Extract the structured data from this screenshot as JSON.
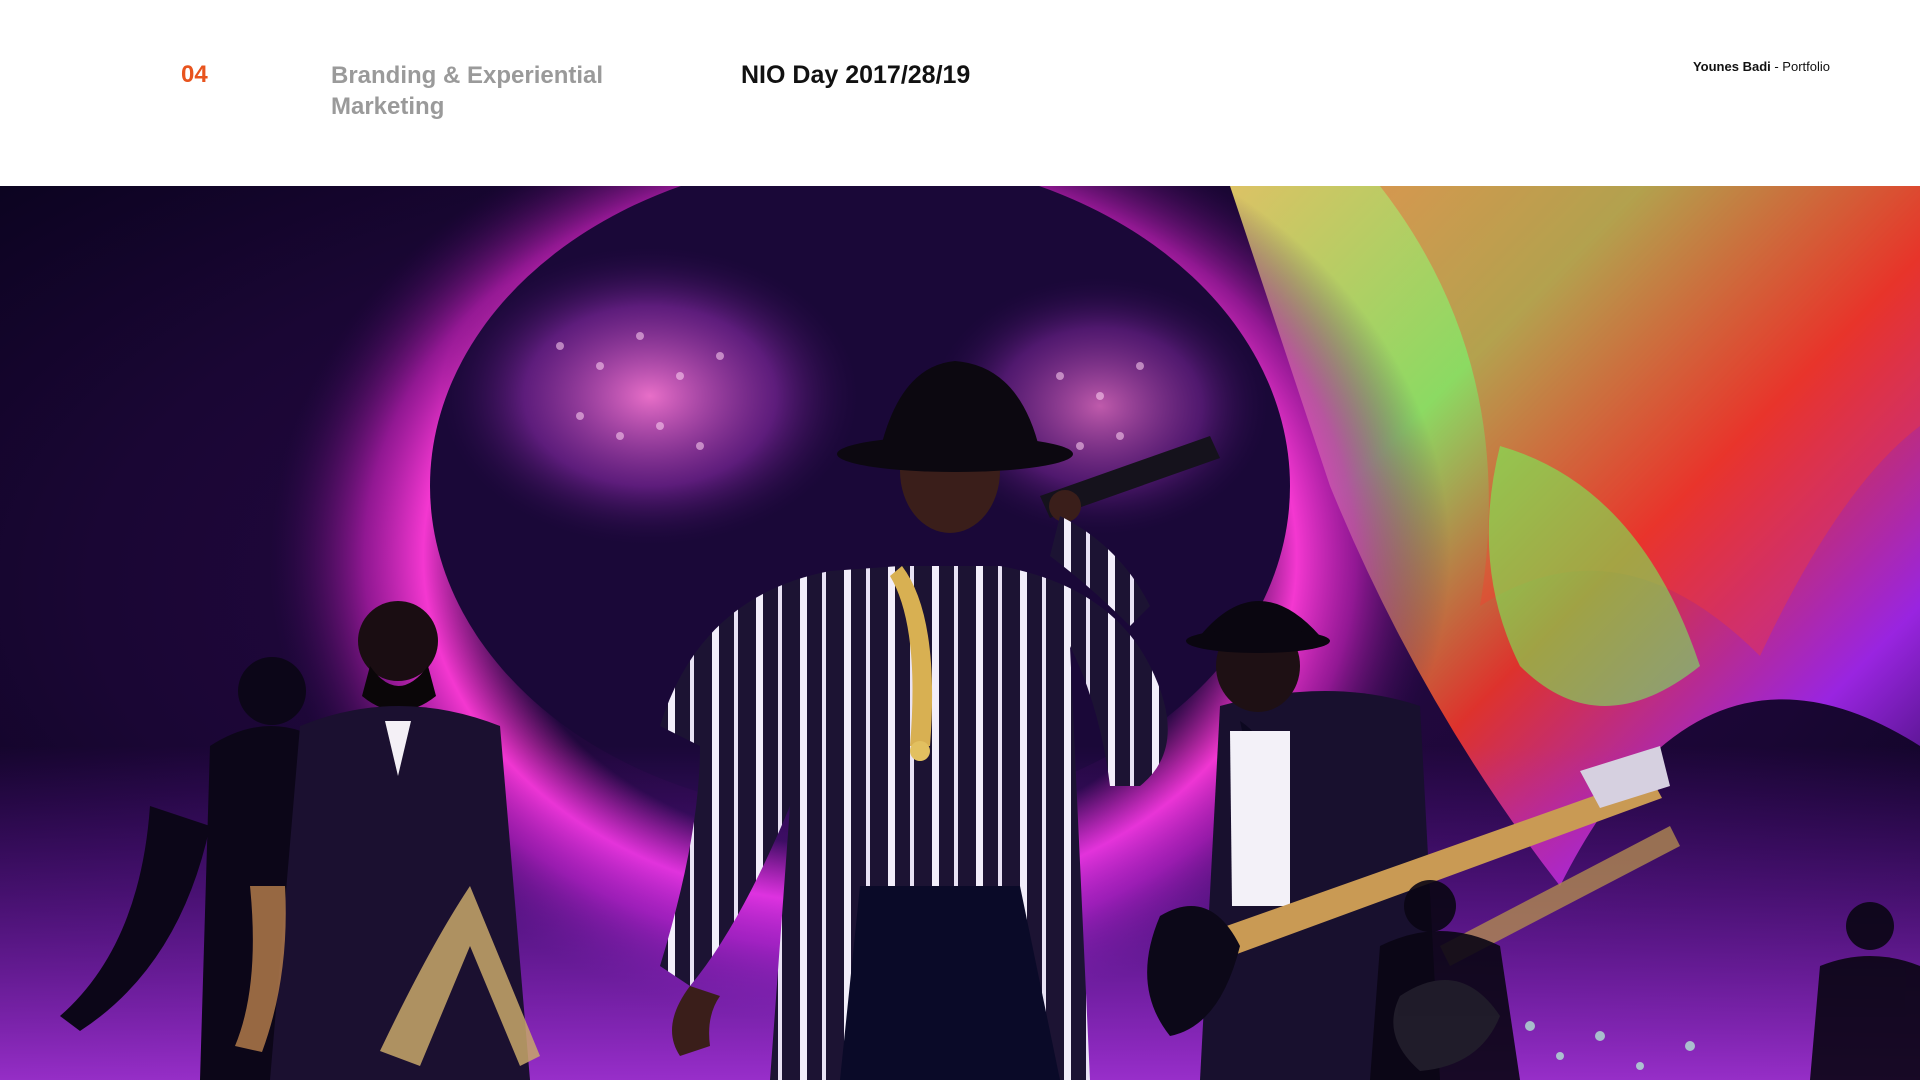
{
  "header": {
    "section_number": "04",
    "section_title": "Branding & Experiential Marketing",
    "project_title": "NIO Day 2017/28/19",
    "author_name": "Younes Badi",
    "author_suffix": " - Portfolio"
  },
  "colors": {
    "accent": "#e8541e",
    "muted_text": "#9a9a9a",
    "primary_text": "#111111",
    "background": "#ffffff"
  },
  "photo": {
    "subject": "concert-stage-photo"
  }
}
